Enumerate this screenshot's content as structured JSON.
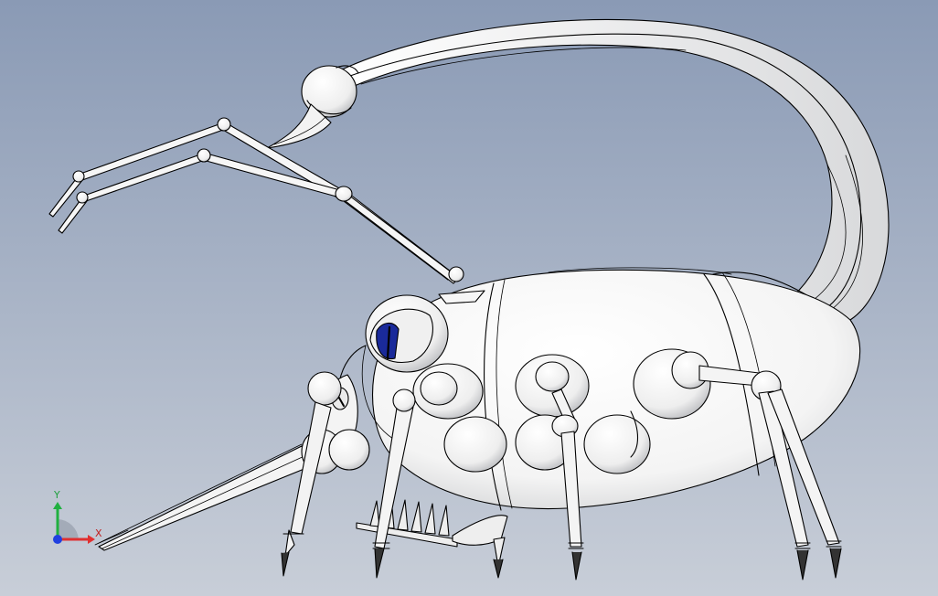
{
  "viewport": {
    "background_top": "#8a9ab5",
    "background_bottom": "#c8ced8",
    "model_fill": "#ffffff",
    "model_shade": "#d9dadc",
    "edge_color": "#000000",
    "eye_color": "#1a2a9a"
  },
  "triad": {
    "x_label": "X",
    "y_label": "Y",
    "x_color": "#e03030",
    "y_color": "#20b040",
    "z_color": "#2040e0",
    "x_label_color": "#c02020",
    "y_label_color": "#20a040"
  }
}
